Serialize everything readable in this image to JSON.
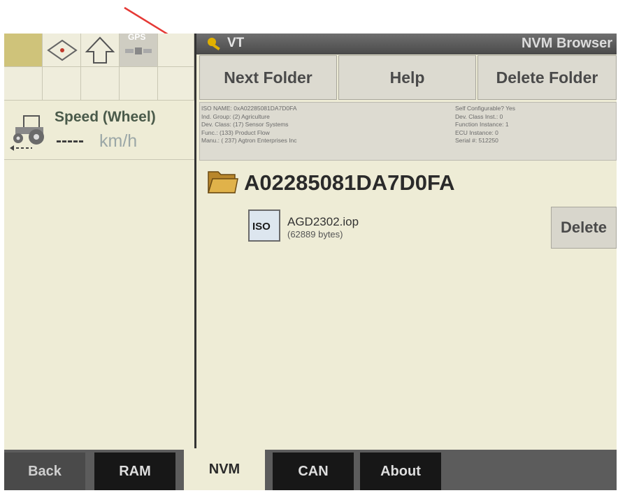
{
  "status_grid": {
    "gps_label": "GPS"
  },
  "speed": {
    "label": "Speed (Wheel)",
    "value": "-----",
    "unit": "km/h"
  },
  "titlebar": {
    "left_title": "VT",
    "right_title": "NVM Browser"
  },
  "softkeys": {
    "next_folder": "Next Folder",
    "help": "Help",
    "delete_folder": "Delete Folder"
  },
  "info_panel": {
    "left_lines": [
      "ISO NAME: 0xA02285081DA7D0FA",
      "Ind. Group: (2) Agriculture",
      "Dev. Class: (17) Sensor Systems",
      "Func.: (133) Product Flow",
      "Manu.: ( 237) Agtron Enterprises Inc"
    ],
    "right_lines": [
      "Self Configurable? Yes",
      "Dev. Class Inst.: 0",
      "Function Instance: 1",
      "ECU Instance: 0",
      "Serial #: 512250"
    ]
  },
  "folder": {
    "name": "A02285081DA7D0FA"
  },
  "file": {
    "icon_label": "ISO",
    "name": "AGD2302.iop",
    "size": "(62889 bytes)",
    "delete_label": "Delete"
  },
  "tabs": [
    {
      "label": "Back"
    },
    {
      "label": "RAM"
    },
    {
      "label": "NVM"
    },
    {
      "label": "CAN"
    },
    {
      "label": "About"
    }
  ],
  "active_tab": "NVM",
  "colors": {
    "background": "#eeecd6",
    "titlebar": "#5a5a5a",
    "annotation_arrow": "#e53935"
  }
}
